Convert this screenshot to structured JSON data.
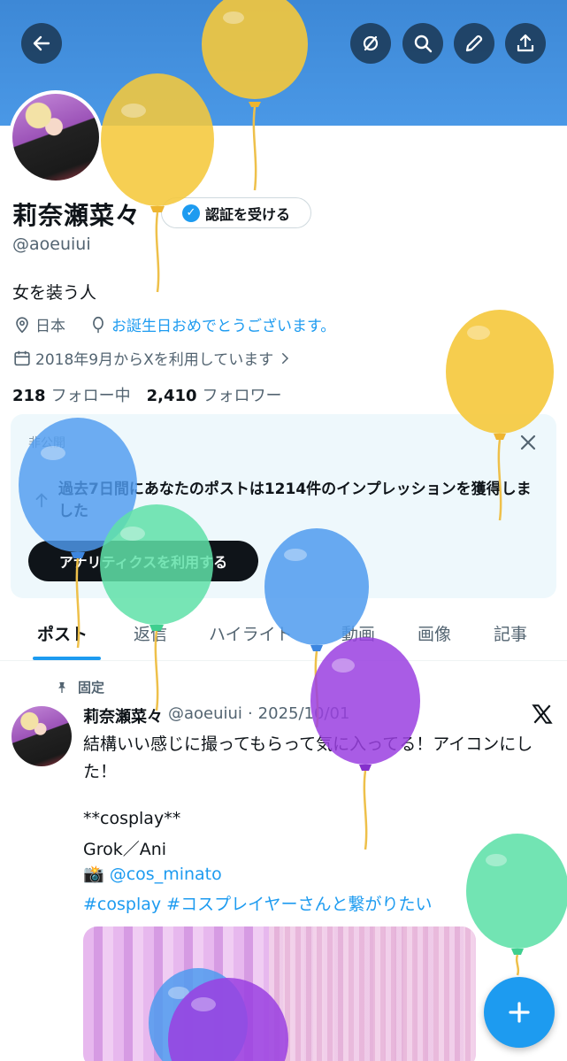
{
  "profile": {
    "name": "莉奈瀬菜々",
    "verify_label": "認証を受ける",
    "handle": "@aoeuiui",
    "bio": "女を装う人",
    "location": "日本",
    "birthday_text": "お誕生日おめでとうございます。",
    "joined_text": "2018年9月からXを利用しています",
    "following_count": "218",
    "following_label": "フォロー中",
    "followers_count": "2,410",
    "followers_label": "フォロワー"
  },
  "notice": {
    "label": "非公開",
    "text": "過去7日間にあなたのポストは1214件のインプレッションを獲得しました",
    "cta": "アナリティクスを利用する"
  },
  "tabs": [
    "ポスト",
    "返信",
    "ハイライト",
    "動画",
    "画像",
    "記事"
  ],
  "post": {
    "pinned_label": "固定",
    "name": "莉奈瀬菜々",
    "handle": "@aoeuiui",
    "separator": "·",
    "date": "2025/10/01",
    "text": "結構いい感じに撮ってもらって気に入ってる！アイコンにした！",
    "line_cosplay": "**cosplay**",
    "line_char": "Grok／Ani",
    "camera_emoji": "📸",
    "mention": "@cos_minato",
    "hashtags": "#cosplay #コスプレイヤーさんと繋がりたい"
  },
  "icons": {
    "back": "back-arrow-icon",
    "hide": "eye-slash-icon",
    "search": "search-icon",
    "edit": "pencil-icon",
    "share": "share-icon",
    "location": "location-pin-icon",
    "balloon": "balloon-icon",
    "calendar": "calendar-icon",
    "close": "close-icon",
    "pin": "pin-icon",
    "x_logo": "x-logo-icon",
    "compose": "plus-icon"
  },
  "colors": {
    "accent": "#1d9bf0",
    "banner": "#4a98e6",
    "balloon_yellow": "#f5c83b",
    "balloon_blue": "#4f9bef",
    "balloon_green": "#5fe0a8",
    "balloon_purple": "#9a3fe0"
  }
}
